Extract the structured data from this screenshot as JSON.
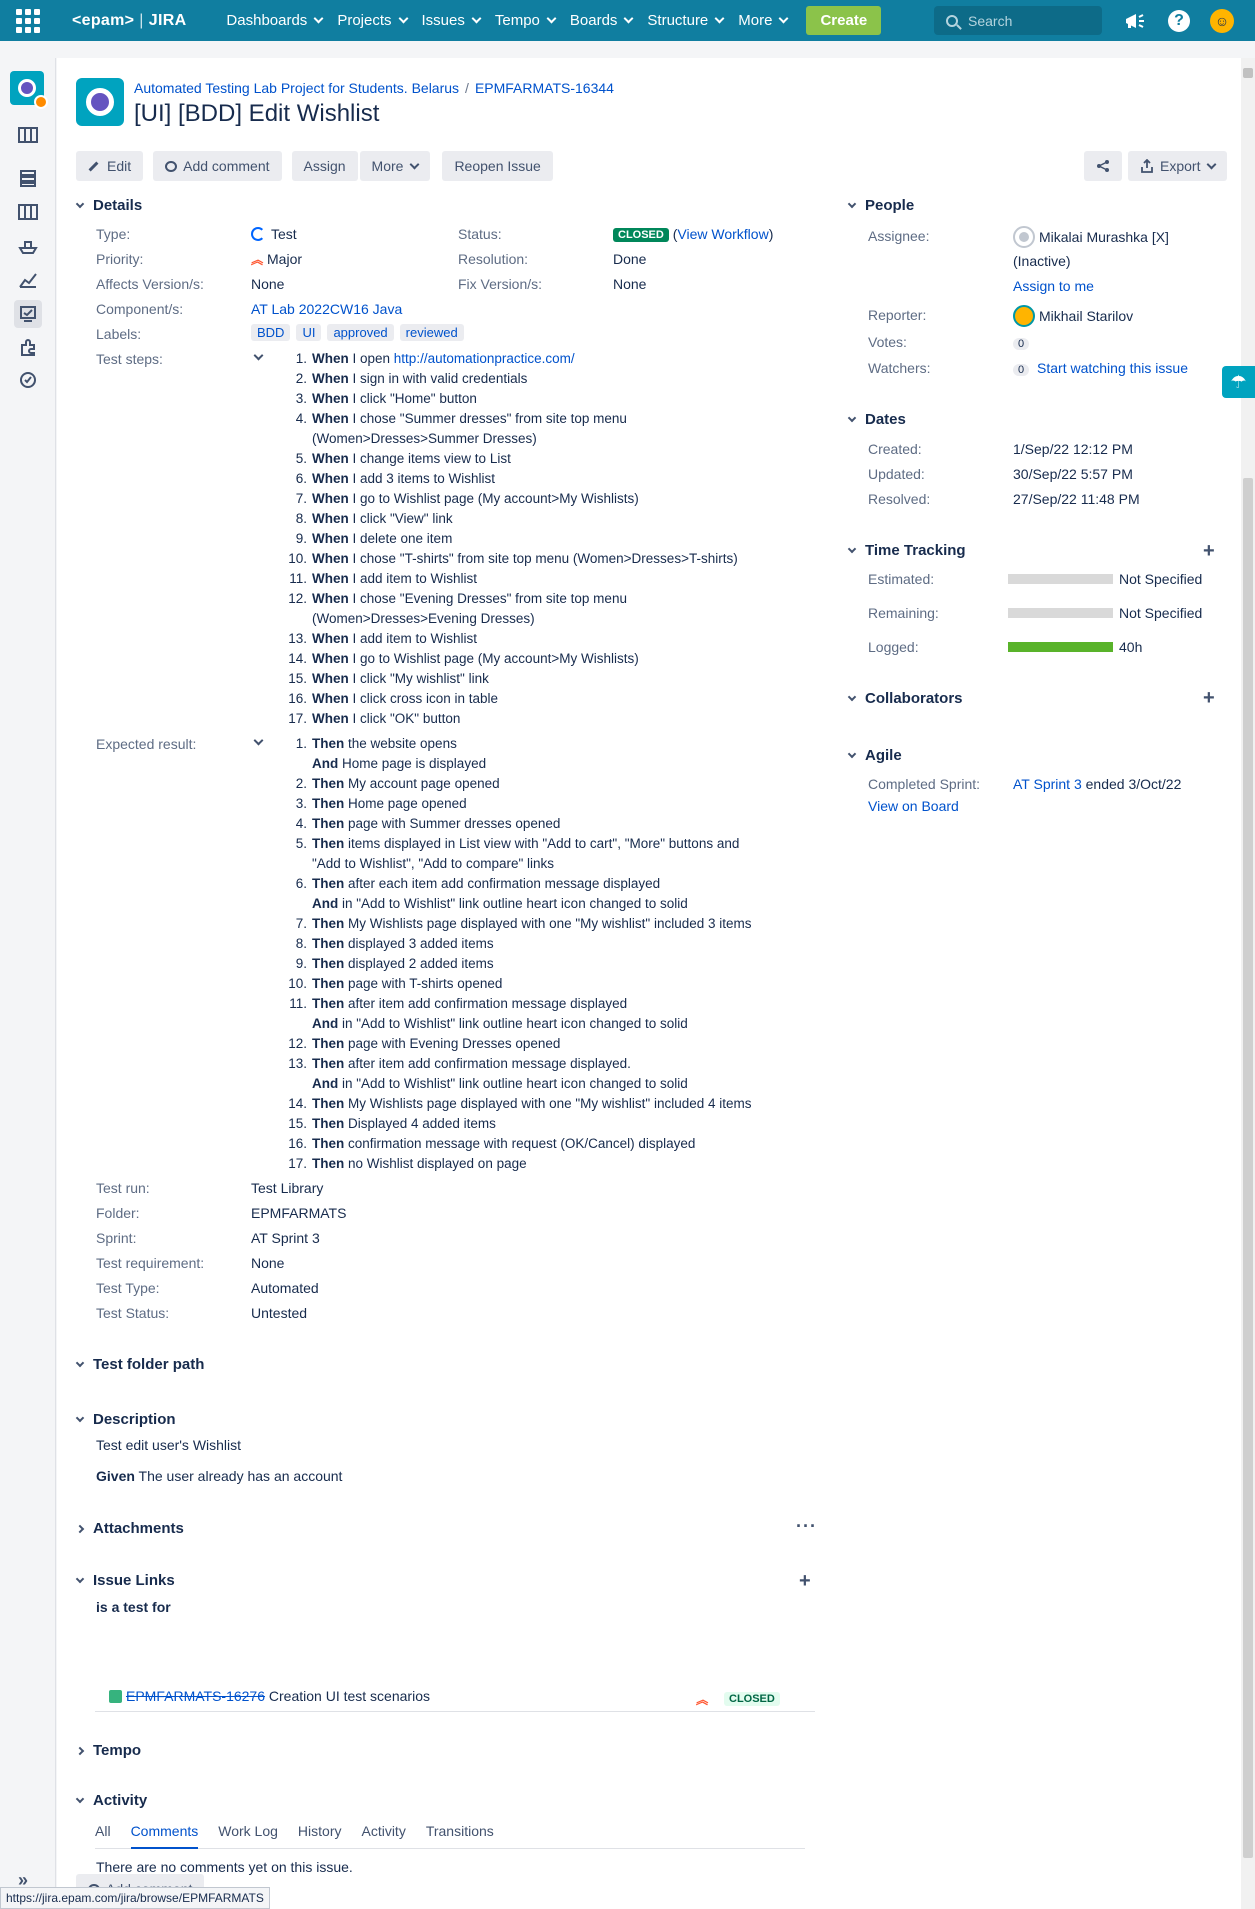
{
  "header": {
    "logo_left": "<epam>",
    "logo_right": "JIRA",
    "nav": [
      "Dashboards",
      "Projects",
      "Issues",
      "Tempo",
      "Boards",
      "Structure",
      "More"
    ],
    "create": "Create",
    "search_placeholder": "Search"
  },
  "breadcrumbs": {
    "project": "Automated Testing Lab Project for Students. Belarus",
    "issue_key": "EPMFARMATS-16344"
  },
  "title": "[UI] [BDD] Edit Wishlist",
  "toolbar": {
    "edit": "Edit",
    "add_comment": "Add comment",
    "assign": "Assign",
    "more": "More",
    "reopen": "Reopen Issue",
    "export": "Export"
  },
  "details": {
    "heading": "Details",
    "type_label": "Type:",
    "type_value": "Test",
    "priority_label": "Priority:",
    "priority_value": "Major",
    "affects_label": "Affects Version/s:",
    "affects_value": "None",
    "component_label": "Component/s:",
    "component_value": "AT Lab 2022CW16 Java",
    "labels_label": "Labels:",
    "labels": [
      "BDD",
      "UI",
      "approved",
      "reviewed"
    ],
    "status_label": "Status:",
    "status_value": "CLOSED",
    "view_workflow": "View Workflow",
    "resolution_label": "Resolution:",
    "resolution_value": "Done",
    "fix_label": "Fix Version/s:",
    "fix_value": "None",
    "test_steps_label": "Test steps:",
    "expected_label": "Expected result:",
    "test_run_label": "Test run:",
    "test_run_value": "Test Library",
    "folder_label": "Folder:",
    "folder_value": "EPMFARMATS",
    "sprint_label": "Sprint:",
    "sprint_value": "AT Sprint 3",
    "requirement_label": "Test requirement:",
    "requirement_value": "None",
    "test_type_label": "Test Type:",
    "test_type_value": "Automated",
    "test_status_label": "Test Status:",
    "test_status_value": "Untested"
  },
  "test_steps": [
    {
      "n": "1.",
      "kw": "When",
      "text": " I open ",
      "link": "http://automationpractice.com/"
    },
    {
      "n": "2.",
      "kw": "When",
      "text": " I sign in with valid credentials"
    },
    {
      "n": "3.",
      "kw": "When",
      "text": " I click \"Home\" button"
    },
    {
      "n": "4.",
      "kw": "When",
      "text": " I chose \"Summer dresses\" from site top menu",
      "cont": "(Women>Dresses>Summer Dresses)"
    },
    {
      "n": "5.",
      "kw": "When",
      "text": " I change items view to List"
    },
    {
      "n": "6.",
      "kw": "When",
      "text": " I add 3 items to Wishlist"
    },
    {
      "n": "7.",
      "kw": "When",
      "text": " I go to Wishlist page (My account>My Wishlists)"
    },
    {
      "n": "8.",
      "kw": "When",
      "text": " I click \"View\" link"
    },
    {
      "n": "9.",
      "kw": "When",
      "text": " I delete one item"
    },
    {
      "n": "10.",
      "kw": "When",
      "text": " I chose \"T-shirts\" from site top menu (Women>Dresses>T-shirts)"
    },
    {
      "n": "11.",
      "kw": "When",
      "text": " I add item to Wishlist"
    },
    {
      "n": "12.",
      "kw": "When",
      "text": " I chose \"Evening Dresses\" from site top menu",
      "cont": "(Women>Dresses>Evening Dresses)"
    },
    {
      "n": "13.",
      "kw": "When",
      "text": " I add item to Wishlist"
    },
    {
      "n": "14.",
      "kw": "When",
      "text": " I go to Wishlist page (My account>My Wishlists)"
    },
    {
      "n": "15.",
      "kw": "When",
      "text": " I click \"My wishlist\" link"
    },
    {
      "n": "16.",
      "kw": "When",
      "text": " I click cross icon in table"
    },
    {
      "n": "17.",
      "kw": "When",
      "text": " I click \"OK\" button"
    }
  ],
  "expected": [
    {
      "n": "1.",
      "kw": "Then",
      "text": " the website opens",
      "and": " Home page is displayed"
    },
    {
      "n": "2.",
      "kw": "Then",
      "text": " My account page opened"
    },
    {
      "n": "3.",
      "kw": "Then",
      "text": " Home page opened"
    },
    {
      "n": "4.",
      "kw": "Then",
      "text": " page with Summer dresses opened"
    },
    {
      "n": "5.",
      "kw": "Then",
      "text": " items displayed in List view with \"Add to cart\", \"More\" buttons and",
      "cont": "\"Add to Wishlist\", \"Add to compare\" links"
    },
    {
      "n": "6.",
      "kw": "Then",
      "text": " after each item add confirmation  message displayed",
      "and": " in \"Add to Wishlist\" link outline heart icon changed to solid"
    },
    {
      "n": "7.",
      "kw": "Then",
      "text": " My Wishlists page displayed with one \"My wishlist\" included 3 items"
    },
    {
      "n": "8.",
      "kw": "Then",
      "text": " displayed 3 added items"
    },
    {
      "n": "9.",
      "kw": "Then",
      "text": " displayed 2 added items"
    },
    {
      "n": "10.",
      "kw": "Then",
      "text": " page with T-shirts opened"
    },
    {
      "n": "11.",
      "kw": "Then",
      "text": " after item add confirmation message displayed",
      "and": " in \"Add to Wishlist\" link outline heart icon changed to solid"
    },
    {
      "n": "12.",
      "kw": "Then",
      "text": " page with Evening Dresses opened"
    },
    {
      "n": "13.",
      "kw": "Then",
      "text": " after item add confirmation message displayed.",
      "and": " in \"Add to Wishlist\" link outline heart icon changed to solid"
    },
    {
      "n": "14.",
      "kw": "Then",
      "text": " My Wishlists page displayed with one \"My wishlist\" included 4 items"
    },
    {
      "n": "15.",
      "kw": "Then",
      "text": " Displayed 4 added items"
    },
    {
      "n": "16.",
      "kw": "Then",
      "text": " confirmation message with request (OK/Cancel) displayed"
    },
    {
      "n": "17.",
      "kw": "Then",
      "text": " no Wishlist displayed on page"
    }
  ],
  "and_kw": "And",
  "test_folder_path": "Test folder path",
  "description": {
    "heading": "Description",
    "line1": "Test edit user's Wishlist",
    "given_kw": "Given",
    "given_text": " The user already has an account"
  },
  "attachments": "Attachments",
  "issue_links": {
    "heading": "Issue Links",
    "relation": "is a test for",
    "key": "EPMFARMATS-16276",
    "summary": "Creation UI test scenarios",
    "status": "CLOSED"
  },
  "tempo": "Tempo",
  "activity": {
    "heading": "Activity",
    "tabs": [
      "All",
      "Comments",
      "Work Log",
      "History",
      "Activity",
      "Transitions"
    ],
    "empty": "There are no comments yet on this issue.",
    "add_comment": "Add comment"
  },
  "people": {
    "heading": "People",
    "assignee_label": "Assignee:",
    "assignee": "Mikalai Murashka [X]",
    "inactive": "(Inactive)",
    "assign_to_me": "Assign to me",
    "reporter_label": "Reporter:",
    "reporter": "Mikhail Starilov",
    "votes_label": "Votes:",
    "votes": "0",
    "watchers_label": "Watchers:",
    "watchers": "0",
    "start_watching": "Start watching this issue"
  },
  "dates": {
    "heading": "Dates",
    "created_label": "Created:",
    "created": "1/Sep/22 12:12 PM",
    "updated_label": "Updated:",
    "updated": "30/Sep/22 5:57 PM",
    "resolved_label": "Resolved:",
    "resolved": "27/Sep/22 11:48 PM"
  },
  "time_tracking": {
    "heading": "Time Tracking",
    "estimated_label": "Estimated:",
    "estimated": "Not Specified",
    "remaining_label": "Remaining:",
    "remaining": "Not Specified",
    "logged_label": "Logged:",
    "logged": "40h"
  },
  "collaborators": "Collaborators",
  "agile": {
    "heading": "Agile",
    "sprint_label": "Completed Sprint:",
    "sprint": "AT Sprint 3",
    "ended": " ended 3/Oct/22",
    "view_on_board": "View on Board"
  },
  "status_url": "https://jira.epam.com/jira/browse/EPMFARMATS",
  "colors": {
    "topbar": "#107ea0",
    "link": "#0052cc",
    "create": "#8bc34a",
    "closed": "#00875a",
    "logged_bar": "#59b32a"
  }
}
